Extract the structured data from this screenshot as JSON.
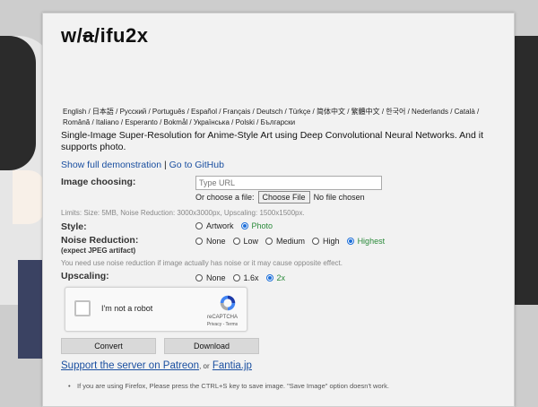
{
  "logo": {
    "part1": "w/",
    "strike": "a",
    "part2": "/ifu2x"
  },
  "languages": "English / 日本語 / Русский / Português / Español / Français / Deutsch / Türkçe / 简体中文 / 繁體中文 / 한국어 / Nederlands / Català / Română / Italiano / Esperanto / Bokmål / Українська / Polski / Български",
  "description": "Single-Image Super-Resolution for Anime-Style Art using Deep Convolutional Neural Networks. And it supports photo.",
  "links": {
    "demo": "Show full demonstration",
    "sep": "|",
    "github": "Go to GitHub"
  },
  "image_choosing": {
    "label": "Image choosing:",
    "url_placeholder": "Type URL",
    "file_prefix": "Or choose a file:",
    "file_button": "Choose File",
    "file_status": "No file chosen",
    "limits": "Limits: Size: 5MB, Noise Reduction: 3000x3000px, Upscaling: 1500x1500px."
  },
  "style": {
    "label": "Style:",
    "options": [
      "Artwork",
      "Photo"
    ],
    "selected": "Photo"
  },
  "noise": {
    "label": "Noise Reduction:",
    "sublabel": "(expect JPEG artifact)",
    "options": [
      "None",
      "Low",
      "Medium",
      "High",
      "Highest"
    ],
    "selected": "Highest",
    "hint": "You need use noise reduction if image actually has noise or it may cause opposite effect."
  },
  "upscaling": {
    "label": "Upscaling:",
    "options": [
      "None",
      "1.6x",
      "2x"
    ],
    "selected": "2x"
  },
  "captcha": {
    "label": "I'm not a robot",
    "brand": "reCAPTCHA",
    "terms": "Privacy - Terms"
  },
  "buttons": {
    "convert": "Convert",
    "download": "Download"
  },
  "support": {
    "patreon": "Support the server on Patreon",
    "or": ", or",
    "fantia": "Fantia.jp"
  },
  "note": "If you are using Firefox, Please press the CTRL+S key to save image. \"Save Image\" option doesn't work.",
  "colors": {
    "selected_option": "#2a8a3a",
    "link": "#1a4fa0",
    "radio_accent": "#1e6fd9"
  }
}
